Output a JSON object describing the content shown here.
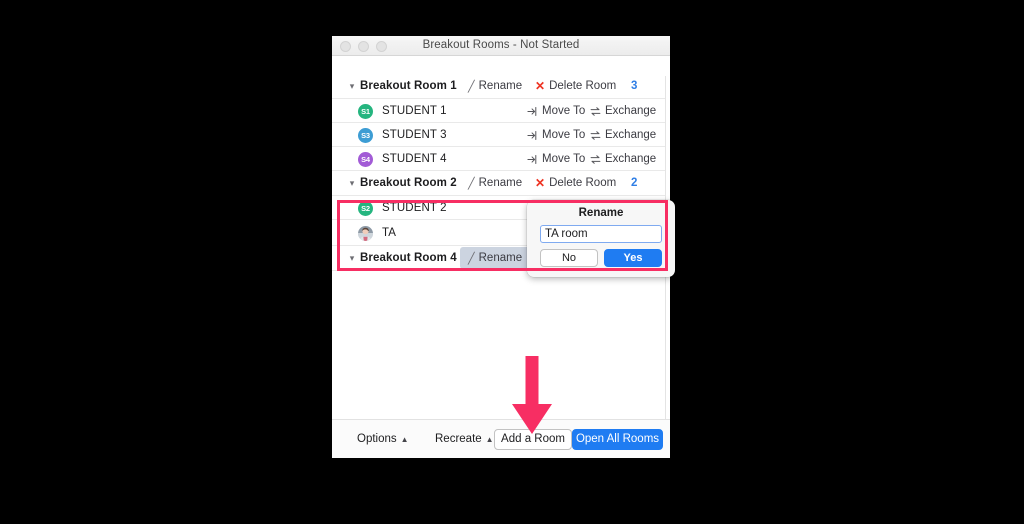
{
  "window": {
    "title": "Breakout Rooms - Not Started",
    "traffic_lights": [
      "close",
      "minimize",
      "zoom"
    ]
  },
  "labels": {
    "rename": "Rename",
    "delete_room": "Delete Room",
    "move_to": "Move To",
    "exchange": "Exchange"
  },
  "rooms": [
    {
      "name": "Breakout Room 1",
      "count": "3",
      "participants": [
        {
          "initials": "S1",
          "name": "STUDENT 1",
          "color": "#25b57f"
        },
        {
          "initials": "S3",
          "name": "STUDENT 3",
          "color": "#3d9dd4"
        },
        {
          "initials": "S4",
          "name": "STUDENT 4",
          "color": "#a25bd6"
        }
      ]
    },
    {
      "name": "Breakout Room 2",
      "count": "2",
      "participants": [
        {
          "initials": "S2",
          "name": "STUDENT 2",
          "color": "#25b57f"
        },
        {
          "initials": "",
          "name": "TA",
          "color": "#b9c3cc"
        }
      ]
    },
    {
      "name": "Breakout Room 4",
      "count": "",
      "participants": []
    }
  ],
  "dialog": {
    "title": "Rename",
    "input_value": "TA room",
    "input_placeholder": "",
    "no_label": "No",
    "yes_label": "Yes"
  },
  "footer": {
    "options": "Options",
    "recreate": "Recreate",
    "add_room": "Add a Room",
    "open_all_rooms": "Open All Rooms"
  },
  "annotations": {
    "highlight_color": "#f72e63",
    "arrow_color": "#f72e63",
    "arrow_target": "Add a Room"
  },
  "colors": {
    "accent_blue": "#1f7cf2",
    "count_blue": "#2f7ee5",
    "delete_red": "#ee3322"
  }
}
